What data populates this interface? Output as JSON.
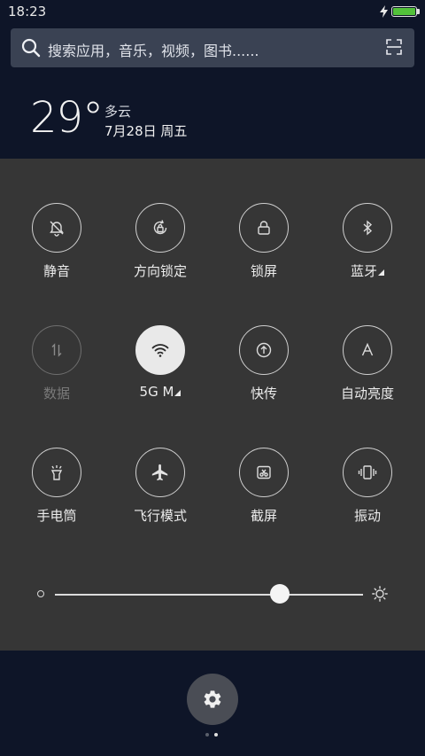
{
  "status_bar": {
    "time": "18:23",
    "battery_level": 1.0,
    "charging": true,
    "battery_color": "#52c13a"
  },
  "search": {
    "placeholder": "搜索应用，音乐，视频，图书......",
    "icon": "search-icon",
    "action_icon": "scan-icon"
  },
  "weather": {
    "temperature": "29°",
    "condition": "多云",
    "date": "7月28日 周五"
  },
  "toggles": [
    {
      "label": "静音",
      "icon": "bell-muted-icon",
      "state": "off"
    },
    {
      "label": "方向锁定",
      "icon": "rotation-lock-icon",
      "state": "off"
    },
    {
      "label": "锁屏",
      "icon": "lock-icon",
      "state": "off"
    },
    {
      "label": "蓝牙",
      "icon": "bluetooth-icon",
      "state": "off",
      "has_menu": true
    },
    {
      "label": "数据",
      "icon": "mobile-data-icon",
      "state": "disabled"
    },
    {
      "label": "5G M",
      "icon": "wifi-icon",
      "state": "on",
      "has_menu": true
    },
    {
      "label": "快传",
      "icon": "quick-share-icon",
      "state": "off"
    },
    {
      "label": "自动亮度",
      "icon": "auto-brightness-icon",
      "state": "off"
    },
    {
      "label": "手电筒",
      "icon": "flashlight-icon",
      "state": "off"
    },
    {
      "label": "飞行模式",
      "icon": "airplane-icon",
      "state": "off"
    },
    {
      "label": "截屏",
      "icon": "screenshot-icon",
      "state": "off"
    },
    {
      "label": "振动",
      "icon": "vibrate-icon",
      "state": "off"
    }
  ],
  "brightness": {
    "level": 0.73
  },
  "settings": {
    "icon": "gear-icon"
  },
  "pager": {
    "count": 2,
    "active": 1
  },
  "colors": {
    "background": "#0e1528",
    "panel": "#363636",
    "search_bar": "#3a4253",
    "active_toggle": "#e9e9e9"
  }
}
